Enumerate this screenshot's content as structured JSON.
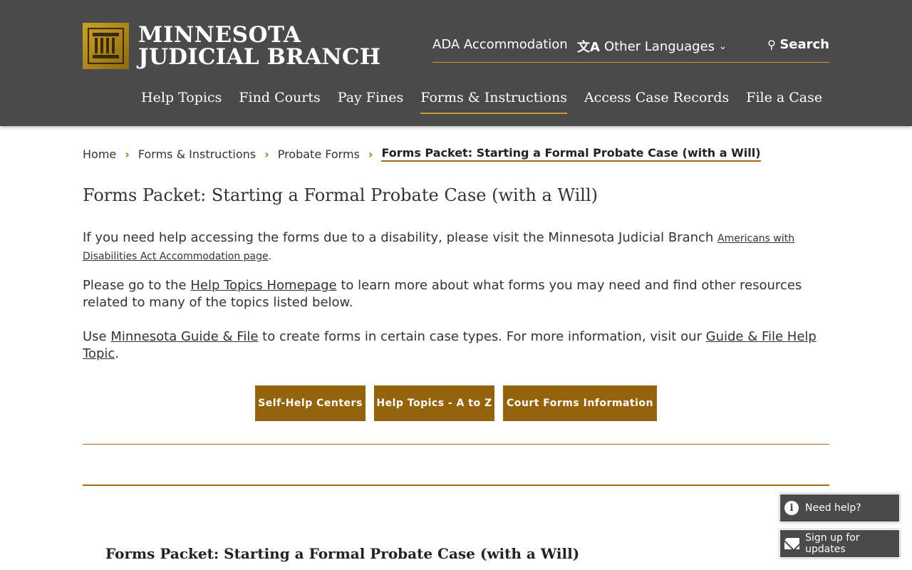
{
  "header": {
    "logo_line1": "MINNESOTA",
    "logo_line2": "JUDICIAL BRANCH",
    "utility": {
      "ada": "ADA Accommodation",
      "languages": "Other Languages",
      "search": "Search"
    },
    "nav": [
      {
        "label": "Help Topics"
      },
      {
        "label": "Find Courts"
      },
      {
        "label": "Pay Fines"
      },
      {
        "label": "Forms & Instructions",
        "active": true
      },
      {
        "label": "Access Case Records"
      },
      {
        "label": "File a Case"
      }
    ]
  },
  "breadcrumb": {
    "items": [
      "Home",
      "Forms & Instructions",
      "Probate Forms"
    ],
    "current": "Forms Packet: Starting a Formal Probate Case (with a Will)"
  },
  "main": {
    "title": "Forms Packet: Starting a Formal Probate Case (with a Will)",
    "p1_text": "If you need help accessing the forms due to a disability, please visit the Minnesota Judicial Branch ",
    "p1_link": "Americans with Disabilities Act Accommodation page",
    "p1_end": ".",
    "p2_pre": "Please go to the ",
    "p2_link": "Help Topics Homepage",
    "p2_post": " to learn more about what forms you may need and find other resources related to many of the topics listed below.",
    "p3_pre": "Use ",
    "p3_link1": "Minnesota Guide & File",
    "p3_mid": " to create forms in certain case types. For more information, visit our ",
    "p3_link2": "Guide & File Help Topic",
    "p3_end": ".",
    "buttons": [
      "Self-Help Centers",
      "Help Topics - A to Z",
      "Court Forms Information"
    ],
    "section_title": "Forms Packet: Starting a Formal Probate Case (with a Will)"
  },
  "widgets": {
    "help": "Need help?",
    "signup": "Sign up for updates"
  },
  "colors": {
    "header_bg": "#4a4a4a",
    "accent_gold": "#93640d",
    "rule_gold": "#a06e0c"
  }
}
